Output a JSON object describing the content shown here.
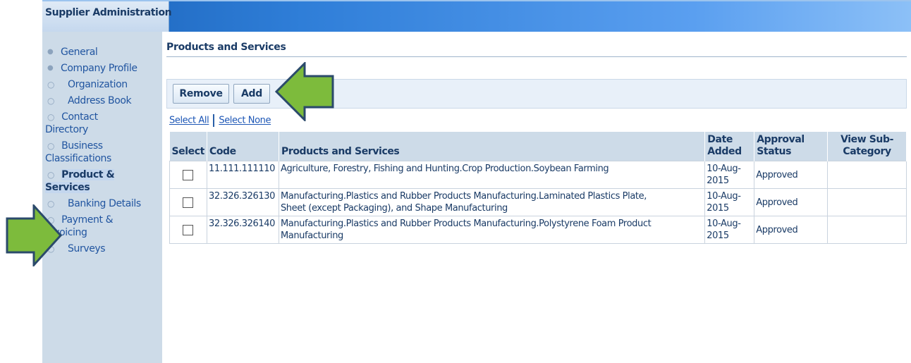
{
  "header": {
    "title": "Supplier Administration"
  },
  "sidebar": {
    "items": [
      {
        "label": "General",
        "level": 1
      },
      {
        "label": "Company Profile",
        "level": 1
      },
      {
        "label": "Organization",
        "level": 2
      },
      {
        "label": "Address Book",
        "level": 2
      },
      {
        "label_line1": "Contact",
        "label_line2": "Directory",
        "level": 2
      },
      {
        "label_line1": "Business",
        "label_line2": "Classifications",
        "level": 2
      },
      {
        "label_line1": "Product &",
        "label_line2": "Services",
        "level": 2,
        "selected": true
      },
      {
        "label": "Banking Details",
        "level": 2
      },
      {
        "label_line1": "Payment &",
        "label_line2": "Invoicing",
        "level": 2
      },
      {
        "label": "Surveys",
        "level": 2
      }
    ]
  },
  "main": {
    "section_title": "Products and Services",
    "toolbar": {
      "remove_label": "Remove",
      "add_label": "Add"
    },
    "links": {
      "select_all": "Select All",
      "select_none": "Select None"
    },
    "table": {
      "headers": {
        "select": "Select",
        "code": "Code",
        "products": "Products and Services",
        "date_line1": "Date",
        "date_line2": "Added",
        "status_line1": "Approval",
        "status_line2": "Status",
        "view_line1": "View Sub-",
        "view_line2": "Category"
      },
      "rows": [
        {
          "code": "11.111.111110",
          "products_line1": "Agriculture, Forestry, Fishing and Hunting.Crop Production.Soybean Farming",
          "products_line2": "",
          "date_line1": "10-Aug-",
          "date_line2": "2015",
          "status": "Approved",
          "selected": false
        },
        {
          "code": "32.326.326130",
          "products_line1": "Manufacturing.Plastics and Rubber Products Manufacturing.Laminated Plastics Plate,",
          "products_line2": "Sheet (except Packaging), and Shape Manufacturing",
          "date_line1": "10-Aug-",
          "date_line2": "2015",
          "status": "Approved",
          "selected": false
        },
        {
          "code": "32.326.326140",
          "products_line1": "Manufacturing.Plastics and Rubber Products Manufacturing.Polystyrene Foam Product",
          "products_line2": "Manufacturing",
          "date_line1": "10-Aug-",
          "date_line2": "2015",
          "status": "Approved",
          "selected": false
        }
      ]
    }
  },
  "annotations": {
    "arrow_color": "#7dbb3c",
    "arrow_border": "#2b4a6b"
  }
}
